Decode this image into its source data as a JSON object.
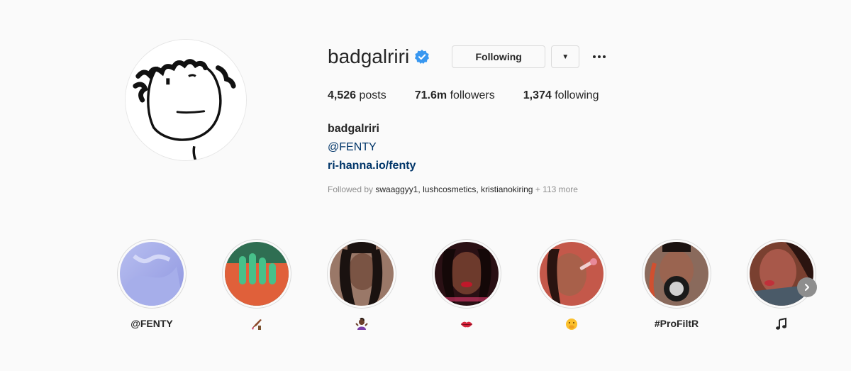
{
  "profile": {
    "username": "badgalriri",
    "verified_icon": "verified-badge-icon",
    "follow_label": "Following",
    "dropdown_icon": "caret-down-icon",
    "more_icon": "more-options-icon",
    "avatar_icon": "stick-figure-avatar"
  },
  "stats": {
    "posts_count": "4,526",
    "posts_label": "posts",
    "followers_count": "71.6m",
    "followers_label": "followers",
    "following_count": "1,374",
    "following_label": "following"
  },
  "bio": {
    "name": "badgalriri",
    "mention": "@FENTY",
    "url": "ri-hanna.io/fenty",
    "followed_by_prefix": "Followed by",
    "followed_by_names": "swaaggyy1, lushcosmetics, kristianokiring",
    "followed_by_more": "+ 113 more"
  },
  "highlights": [
    {
      "label": "@FENTY",
      "icon": null
    },
    {
      "label": "",
      "icon": "nail-polish-icon"
    },
    {
      "label": "",
      "icon": "woman-shrugging-icon"
    },
    {
      "label": "",
      "icon": "kiss-mark-icon"
    },
    {
      "label": "",
      "icon": "face-with-hand-over-mouth-icon"
    },
    {
      "label": "#ProFiltR",
      "icon": null
    },
    {
      "label": "",
      "icon": "musical-notes-icon"
    }
  ],
  "colors": {
    "background": "#fafafa",
    "text": "#262626",
    "link": "#003569",
    "muted": "#8e8e8e",
    "verified": "#3897f0"
  },
  "next_icon": "chevron-right-icon"
}
